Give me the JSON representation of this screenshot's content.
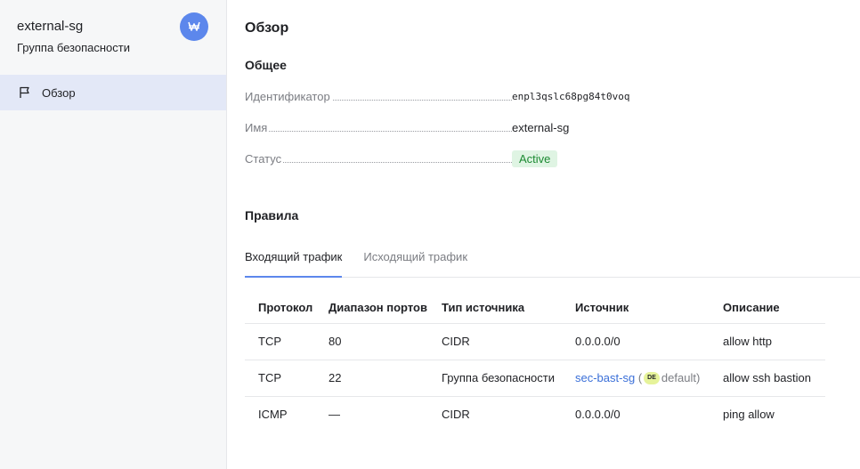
{
  "sidebar": {
    "title": "external-sg",
    "subtitle": "Группа безопасности",
    "badge_icon": "security-group-icon",
    "items": [
      {
        "label": "Обзор",
        "icon": "flag-icon",
        "active": true
      }
    ]
  },
  "main": {
    "title": "Обзор",
    "general": {
      "title": "Общее",
      "fields": [
        {
          "key": "Идентификатор",
          "value": "enpl3qslc68pg84t0voq"
        },
        {
          "key": "Имя",
          "value": "external-sg"
        },
        {
          "key": "Статус",
          "value": "Active"
        }
      ]
    },
    "rules": {
      "title": "Правила",
      "tabs": [
        {
          "label": "Входящий трафик",
          "active": true
        },
        {
          "label": "Исходящий трафик",
          "active": false
        }
      ],
      "columns": [
        "Протокол",
        "Диапазон портов",
        "Тип источника",
        "Источник",
        "Описание"
      ],
      "rows": [
        {
          "protocol": "TCP",
          "ports": "80",
          "source_type": "CIDR",
          "source": "0.0.0.0/0",
          "description": "allow http"
        },
        {
          "protocol": "TCP",
          "ports": "22",
          "source_type": "Группа безопасности",
          "source": "sec-bast-sg",
          "source_badge": "DE",
          "source_note": "default",
          "description": "allow ssh bastion"
        },
        {
          "protocol": "ICMP",
          "ports": "—",
          "source_type": "CIDR",
          "source": "0.0.0.0/0",
          "description": "ping allow"
        }
      ]
    }
  },
  "colors": {
    "accent": "#5c87ec",
    "link": "#3a6fd8",
    "status_bg": "#dff4e3",
    "status_text": "#1c8a32"
  }
}
